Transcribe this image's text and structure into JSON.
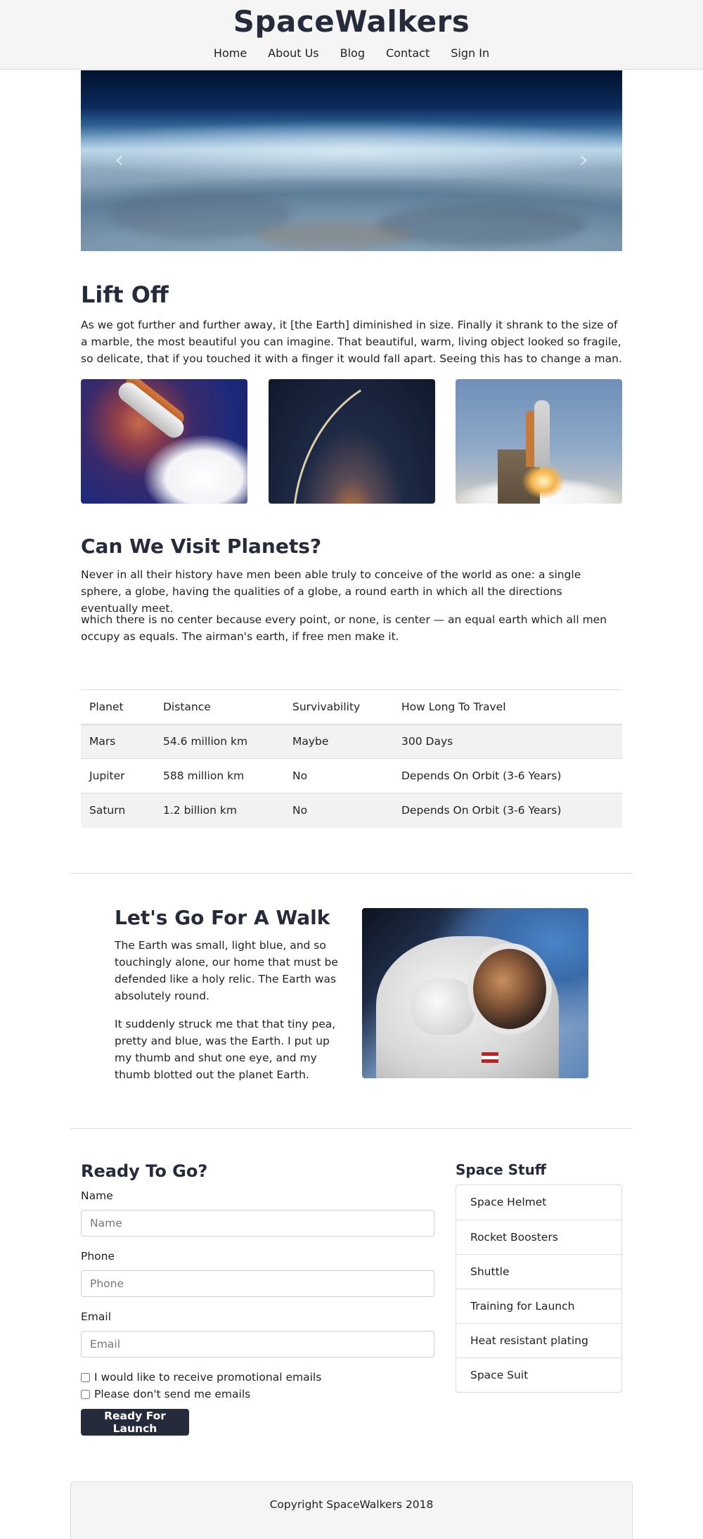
{
  "header": {
    "title": "SpaceWalkers",
    "nav": [
      "Home",
      "About Us",
      "Blog",
      "Contact",
      "Sign In"
    ]
  },
  "carousel": {
    "prev_icon": "chevron-left-icon",
    "next_icon": "chevron-right-icon",
    "prev_glyph": "‹",
    "next_glyph": "›"
  },
  "lift_off": {
    "title": "Lift Off",
    "text": "As we got further and further away, it [the Earth] diminished in size. Finally it shrank to the size of a marble, the most beautiful you can imagine. That beautiful, warm, living object looked so fragile, so delicate, that if you touched it with a finger it would fall apart. Seeing this has to change a man."
  },
  "visit": {
    "title": "Can We Visit Planets?",
    "p1": "Never in all their history have men been able truly to conceive of the world as one: a single sphere, a globe, having the qualities of a globe, a round earth in which all the directions eventually meet.",
    "p2": "which there is no center because every point, or none, is center — an equal earth which all men occupy as equals. The airman's earth, if free men make it."
  },
  "table": {
    "headers": [
      "Planet",
      "Distance",
      "Survivability",
      "How Long To Travel"
    ],
    "rows": [
      [
        "Mars",
        "54.6 million km",
        "Maybe",
        "300 Days"
      ],
      [
        "Jupiter",
        "588 million km",
        "No",
        "Depends On Orbit (3-6 Years)"
      ],
      [
        "Saturn",
        "1.2 billion km",
        "No",
        "Depends On Orbit (3-6 Years)"
      ]
    ]
  },
  "walk": {
    "title": "Let's Go For A Walk",
    "p1": "The Earth was small, light blue, and so touchingly alone, our home that must be defended like a holy relic. The Earth was absolutely round.",
    "p2": "It suddenly struck me that that tiny pea, pretty and blue, was the Earth. I put up my thumb and shut one eye, and my thumb blotted out the planet Earth."
  },
  "form": {
    "title": "Ready To Go?",
    "name_label": "Name",
    "name_placeholder": "Name",
    "phone_label": "Phone",
    "phone_placeholder": "Phone",
    "email_label": "Email",
    "email_placeholder": "Email",
    "check1": "I would like to receive promotional emails",
    "check2": "Please don't send me emails",
    "submit": "Ready For Launch"
  },
  "sidebar": {
    "title": "Space Stuff",
    "items": [
      "Space Helmet",
      "Rocket Boosters",
      "Shuttle",
      "Training for Launch",
      "Heat resistant plating",
      "Space Suit"
    ]
  },
  "footer": {
    "text": "Copyright SpaceWalkers 2018"
  },
  "colors": {
    "brand": "#262b3c",
    "header_bg": "#f5f5f5",
    "stripe": "#f2f2f2"
  }
}
